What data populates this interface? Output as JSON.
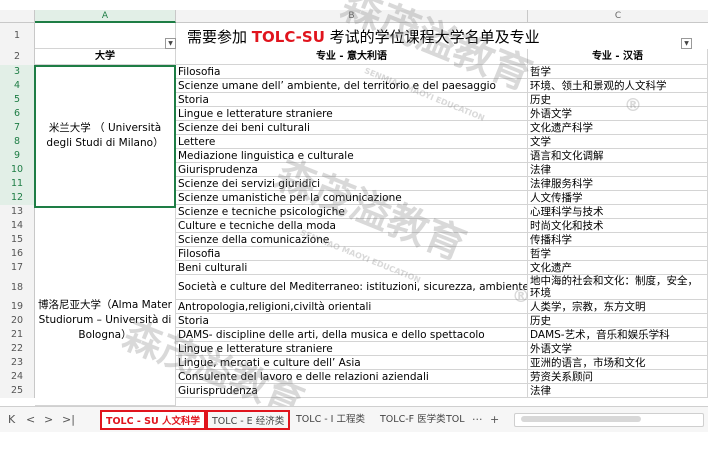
{
  "columns": [
    "A",
    "B",
    "C"
  ],
  "title_prefix": "需要参加 ",
  "title_highlight": "TOLC-SU",
  "title_suffix": " 考试的学位课程大学名单及专业",
  "headers": {
    "university": "大学",
    "major_it": "专业 - 意大利语",
    "major_cn": "专业 - 汉语"
  },
  "row_numbers": [
    "1",
    "2",
    "3",
    "4",
    "5",
    "6",
    "7",
    "8",
    "9",
    "10",
    "11",
    "12",
    "13",
    "14",
    "15",
    "16",
    "17",
    "18",
    "19",
    "20",
    "21",
    "22",
    "23",
    "24",
    "25"
  ],
  "milan": "米兰大学 （ Università degli Studi di Milano）",
  "bologna": "博洛尼亚大学（Alma Mater Studiorum – Università di Bologna）",
  "rows": [
    {
      "it": "Filosofia",
      "cn": "哲学"
    },
    {
      "it": "Scienze umane dell’ ambiente,  del territorio e del paesaggio",
      "cn": "环境、领土和景观的人文科学"
    },
    {
      "it": "Storia",
      "cn": "历史"
    },
    {
      "it": "Lingue e letterature straniere",
      "cn": "外语文学"
    },
    {
      "it": "Scienze dei beni culturali",
      "cn": "文化遗产科学"
    },
    {
      "it": "Lettere",
      "cn": "文学"
    },
    {
      "it": "Mediazione linguistica e culturale",
      "cn": "语言和文化调解"
    },
    {
      "it": "Giurisprudenza",
      "cn": "法律"
    },
    {
      "it": "Scienze dei servizi giuridici",
      "cn": "法律服务科学"
    },
    {
      "it": "Scienze umanistiche per la comunicazione",
      "cn": "人文传播学"
    },
    {
      "it": "Scienze e tecniche psicologiche",
      "cn": "心理科学与技术"
    },
    {
      "it": "Culture e tecniche della moda",
      "cn": "时尚文化和技术"
    },
    {
      "it": "Scienze della comunicazione",
      "cn": "传播科学"
    },
    {
      "it": "Filosofia",
      "cn": "哲学"
    },
    {
      "it": "Beni culturali",
      "cn": "文化遗产"
    },
    {
      "it": "Società e culture del Mediterraneo: istituzioni, sicurezza, ambiente",
      "cn": "地中海的社会和文化：制度，安全，环境"
    },
    {
      "it": "Antropologia,religioni,civiltà orientali",
      "cn": "人类学，宗教，东方文明"
    },
    {
      "it": "Storia",
      "cn": "历史"
    },
    {
      "it": "DAMS- discipline delle arti, della musica e dello spettacolo",
      "cn": "DAMS-艺术，音乐和娱乐学科"
    },
    {
      "it": "Lingue e letterature straniere",
      "cn": "外语文学"
    },
    {
      "it": "Lingue, mercati e culture dell’ Asia",
      "cn": "亚洲的语言，市场和文化"
    },
    {
      "it": "Consulente del lavoro e delle relazioni aziendali",
      "cn": "劳资关系顾问"
    },
    {
      "it": "Giurisprudenza",
      "cn": "法律"
    }
  ],
  "tabs": {
    "nav_first": "K",
    "nav_prev": "<",
    "nav_next": ">",
    "nav_last": ">|",
    "sheet1": "TOLC - SU 人文科学",
    "sheet2": "TOLC - E 经济类",
    "sheet3": "TOLC - I 工程类",
    "sheet4": "TOLC-F 医学类",
    "sheet5": "TOL",
    "more": "···",
    "add": "+"
  },
  "watermark": {
    "cn": "森茂溢教育",
    "en": "SENMIAO MAOYI EDUCATION",
    "reg": "®"
  },
  "colors": {
    "accent_green": "#1e7d45",
    "highlight_red": "#e0141d"
  }
}
